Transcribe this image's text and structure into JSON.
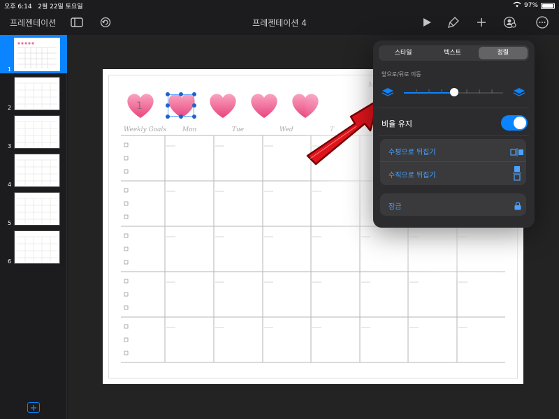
{
  "status": {
    "time": "오후 6:14",
    "date": "2월 22일 토요일",
    "battery": "97%"
  },
  "toolbar": {
    "back_label": "프레젠테이션",
    "title": "프레젠테이션 4"
  },
  "slides": [
    {
      "num": "1"
    },
    {
      "num": "2"
    },
    {
      "num": "3"
    },
    {
      "num": "4"
    },
    {
      "num": "5"
    },
    {
      "num": "6"
    }
  ],
  "slide": {
    "heart_number": "1",
    "headers": [
      "Weekly Goals",
      "Mon",
      "Tue",
      "Wed",
      "T"
    ],
    "corner_mark": "M"
  },
  "popover": {
    "tabs": [
      "스타일",
      "텍스트",
      "정렬"
    ],
    "active_tab": "정렬",
    "move_label": "앞으로/뒤로 이동",
    "slider_value": 0.5,
    "aspect_label": "비율 유지",
    "aspect_on": true,
    "flip_h_label": "수평으로 뒤집기",
    "flip_v_label": "수직으로 뒤집기",
    "lock_label": "잠금"
  },
  "colors": {
    "accent": "#0a84ff",
    "heart": "#f06d9b"
  }
}
